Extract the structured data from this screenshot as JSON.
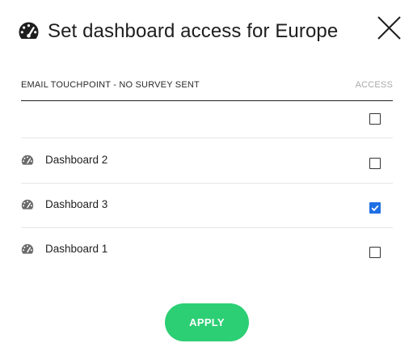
{
  "modal": {
    "title": "Set dashboard access for Europe",
    "header_icon": "dashboard-gauge-icon",
    "close_icon": "close-icon"
  },
  "table": {
    "name_header": "EMAIL TOUCHPOINT - NO SURVEY SENT",
    "access_header": "ACCESS",
    "rows": [
      {
        "label": "",
        "icon": "",
        "checked": false
      },
      {
        "label": "Dashboard 2",
        "icon": "dashboard-gauge-icon",
        "checked": false
      },
      {
        "label": "Dashboard 3",
        "icon": "dashboard-gauge-icon",
        "checked": true
      },
      {
        "label": "Dashboard 1",
        "icon": "dashboard-gauge-icon",
        "checked": false
      }
    ]
  },
  "apply_label": "APPLY",
  "colors": {
    "apply_button": "#2ccf74",
    "checkbox_checked": "#1f6fe5",
    "text": "#1f1f1f"
  }
}
